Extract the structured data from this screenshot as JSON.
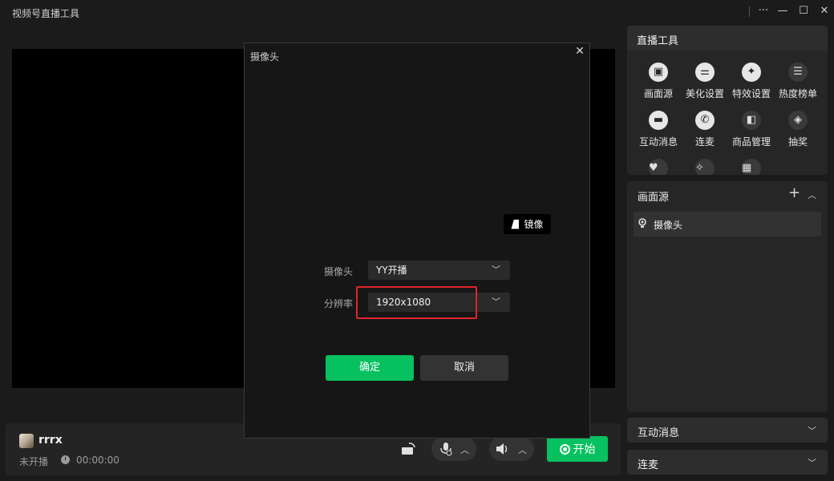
{
  "window": {
    "title": "视频号直播工具",
    "more": "···",
    "minimize": "—",
    "maximize": "☐",
    "close": "✕"
  },
  "bottom": {
    "username": "rrrx",
    "status": "未开播",
    "timer": "00:00:00",
    "start_label": "开始"
  },
  "tools": {
    "header": "直播工具",
    "items": [
      {
        "label": "画面源",
        "icon": "monitor-icon"
      },
      {
        "label": "美化设置",
        "icon": "sliders-icon"
      },
      {
        "label": "特效设置",
        "icon": "sparkle-icon"
      },
      {
        "label": "热度榜单",
        "icon": "list-icon"
      },
      {
        "label": "互动消息",
        "icon": "chat-icon"
      },
      {
        "label": "连麦",
        "icon": "phone-icon"
      },
      {
        "label": "商品管理",
        "icon": "bag-icon"
      },
      {
        "label": "抽奖",
        "icon": "gift-box-icon"
      }
    ]
  },
  "sources": {
    "header": "画面源",
    "add": "+",
    "items": [
      {
        "label": "摄像头"
      }
    ]
  },
  "panels": {
    "interactive": "互动消息",
    "mic_link": "连麦"
  },
  "dialog": {
    "title": "摄像头",
    "close": "✕",
    "mirror_label": "镜像",
    "camera_label": "摄像头",
    "camera_value": "YY开播",
    "resolution_label": "分辨率",
    "resolution_value": "1920x1080",
    "ok": "确定",
    "cancel": "取消"
  },
  "colors": {
    "accent": "#07c160",
    "highlight": "#e0242d",
    "background": "#1b1b1b"
  }
}
